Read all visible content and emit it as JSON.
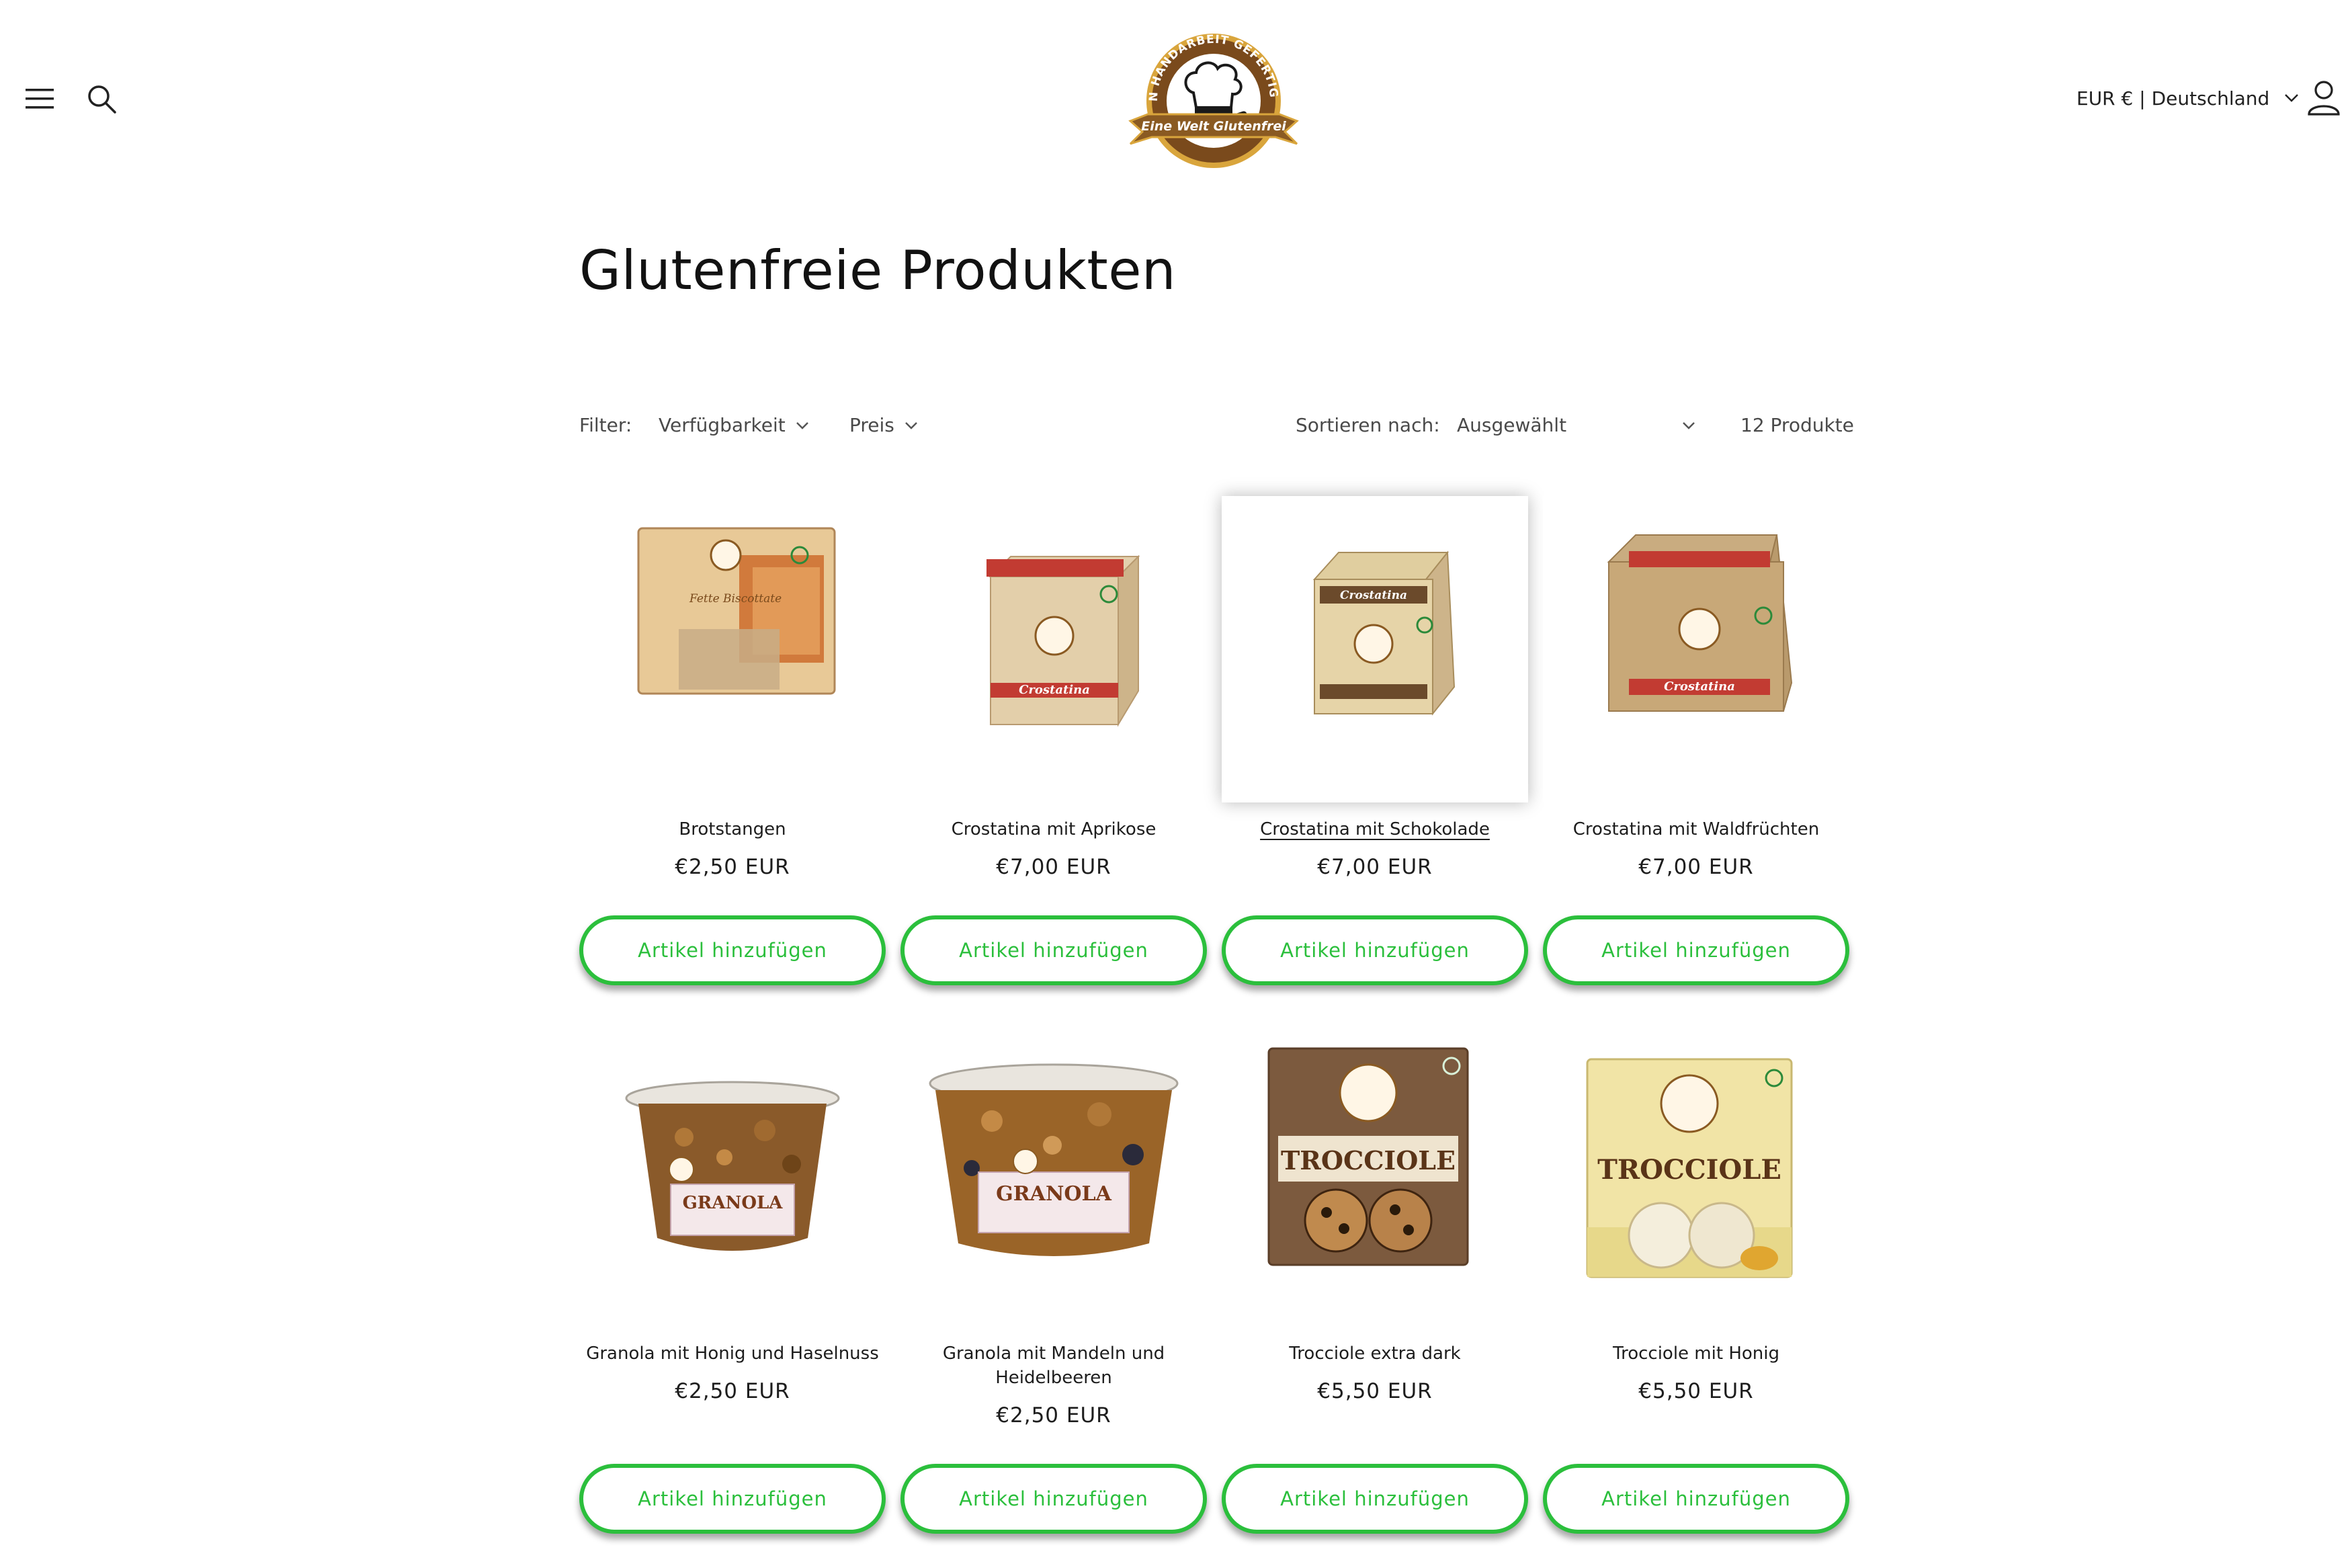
{
  "header": {
    "logo_text_top": "IN HANDARBEIT GEFERTIGT",
    "logo_text_banner": "Eine Welt Glutenfrei",
    "locale_label": "EUR € | Deutschland"
  },
  "page": {
    "title": "Glutenfreie Produkten"
  },
  "toolbar": {
    "filter_label": "Filter:",
    "filter_availability": "Verfügbarkeit",
    "filter_price": "Preis",
    "sort_label": "Sortieren nach:",
    "sort_value": "Ausgewählt",
    "product_count": "12 Produkte"
  },
  "products": [
    {
      "name": "Brotstangen",
      "price": "€2,50 EUR",
      "button": "Artikel hinzufügen",
      "image": "rusk-pack",
      "pack_text": "Fette Biscottate"
    },
    {
      "name": "Crostatina mit Aprikose",
      "price": "€7,00 EUR",
      "button": "Artikel hinzufügen",
      "image": "crostatina-box",
      "pack_text": "Crostatina"
    },
    {
      "name": "Crostatina mit Schokolade",
      "price": "€7,00 EUR",
      "button": "Artikel hinzufügen",
      "image": "crostatina-box",
      "pack_text": "Crostatina"
    },
    {
      "name": "Crostatina mit Waldfrüchten",
      "price": "€7,00 EUR",
      "button": "Artikel hinzufügen",
      "image": "crostatina-box",
      "pack_text": "Crostatina"
    },
    {
      "name": "Granola mit Honig und Haselnuss",
      "price": "€2,50 EUR",
      "button": "Artikel hinzufügen",
      "image": "granola-tub",
      "pack_text": "GRANOLA"
    },
    {
      "name": "Granola mit Mandeln und Heidelbeeren",
      "price": "€2,50 EUR",
      "button": "Artikel hinzufügen",
      "image": "granola-tub",
      "pack_text": "GRANOLA"
    },
    {
      "name": "Trocciole extra dark",
      "price": "€5,50 EUR",
      "button": "Artikel hinzufügen",
      "image": "cookie-box-dark",
      "pack_text": "TROCCIOLE"
    },
    {
      "name": "Trocciole mit Honig",
      "price": "€5,50 EUR",
      "button": "Artikel hinzufügen",
      "image": "cookie-box-light",
      "pack_text": "TROCCIOLE"
    }
  ],
  "colors": {
    "accent": "#2bbf3c",
    "text": "#121212",
    "logo_brown": "#8a5a22",
    "logo_gold": "#d9a53c"
  }
}
